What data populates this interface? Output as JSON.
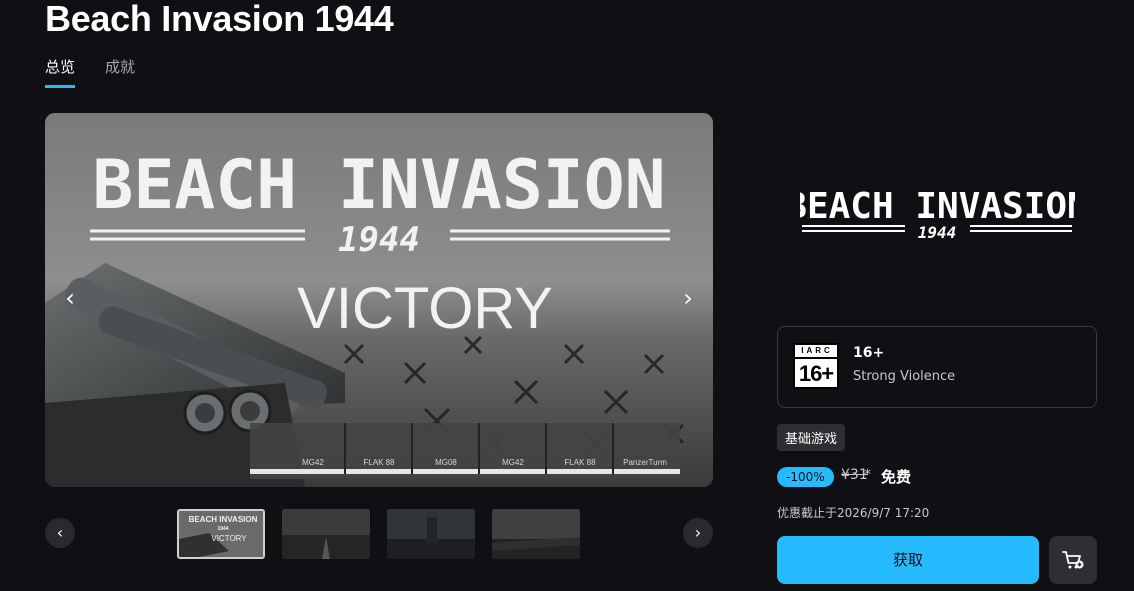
{
  "page": {
    "title": "Beach Invasion 1944",
    "tabs": [
      {
        "label": "总览",
        "active": true
      },
      {
        "label": "成就",
        "active": false
      }
    ]
  },
  "hero": {
    "headline_line1": "BEACH INVASION",
    "headline_year": "1944",
    "overlay_text": "VICTORY",
    "weapon_bar": [
      "MG42",
      "FLAK 88",
      "MG08",
      "MG42",
      "FLAK 88",
      "PanzerTurm"
    ],
    "prev_icon": "chevron-left-icon",
    "next_icon": "chevron-right-icon"
  },
  "thumbnails": {
    "items": [
      {
        "caption_line1": "BEACH INVASION",
        "caption_line2": "1944",
        "caption_line3": "VICTORY",
        "active": true
      },
      {
        "caption_line1": "",
        "active": false
      },
      {
        "caption_line1": "",
        "active": false
      },
      {
        "caption_line1": "",
        "active": false
      }
    ],
    "prev_label": "‹",
    "next_label": "›"
  },
  "sidebar": {
    "logo_line1": "BEACH INVASION",
    "logo_line2": "1944",
    "rating": {
      "org": "IARC",
      "age_badge": "16+",
      "age": "16+",
      "descriptor": "Strong Violence"
    },
    "type_badge": "基础游戏",
    "price": {
      "discount": "-100%",
      "original": "¥31",
      "asterisk": "*",
      "current": "免费"
    },
    "deadline": "优惠截止于2026/9/7 17:20",
    "get_button": "获取",
    "cart_icon": "add-to-cart-icon"
  },
  "colors": {
    "background": "#101014",
    "accent": "#26bbff",
    "panel": "#2f2f33"
  }
}
